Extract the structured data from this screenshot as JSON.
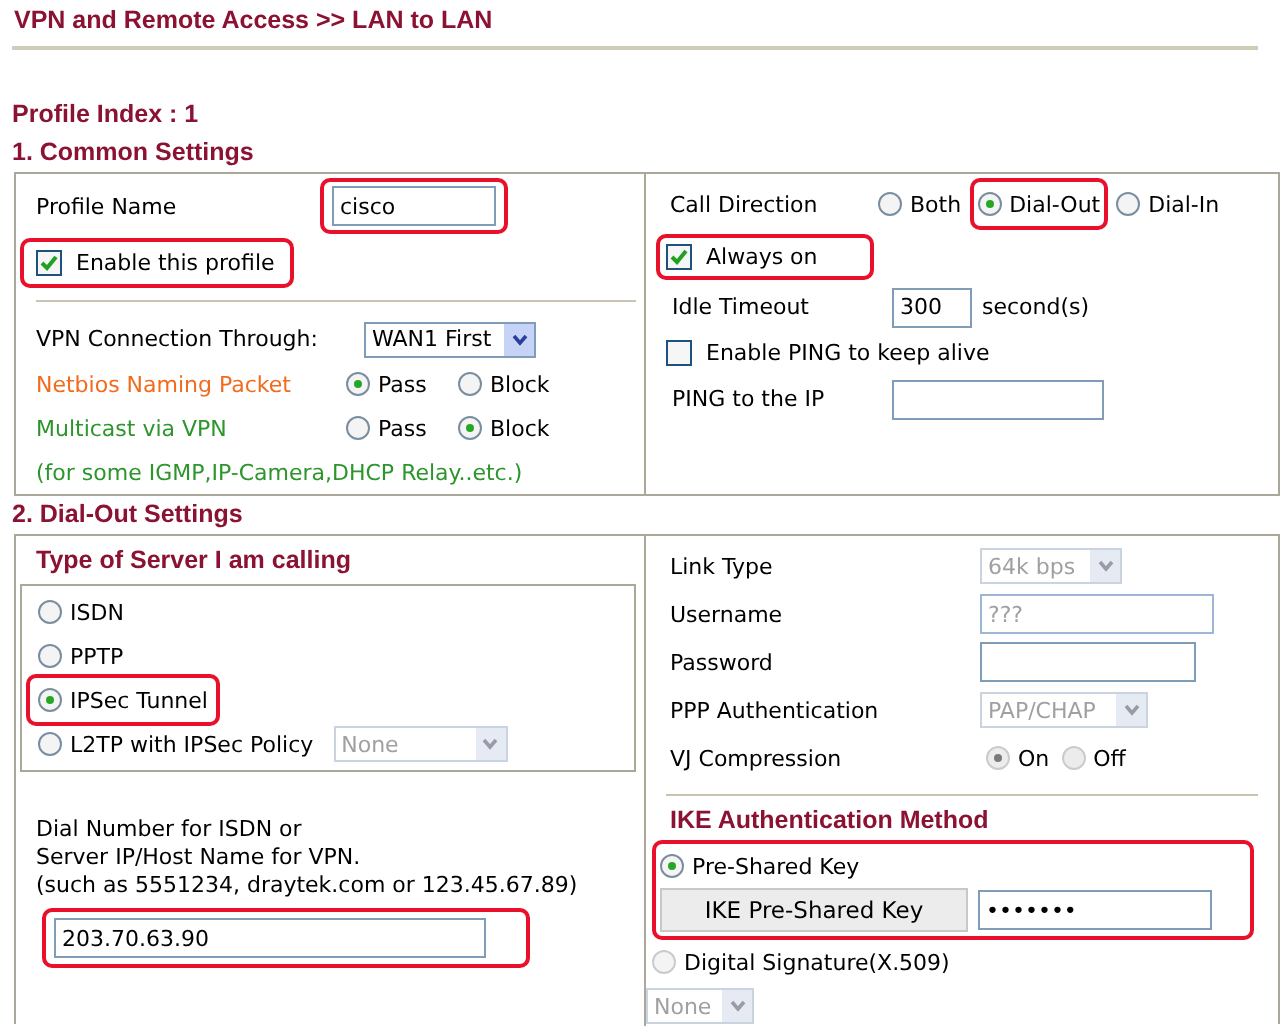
{
  "breadcrumb": "VPN and Remote Access >> LAN to LAN",
  "profile_index": "Profile Index : 1",
  "common_settings": {
    "title": "1. Common Settings",
    "profile_name": {
      "label": "Profile Name",
      "value": "cisco",
      "highlighted": true
    },
    "enable_profile": {
      "label": "Enable this profile",
      "checked": true,
      "highlighted": true
    },
    "vpn_connection": {
      "label": "VPN Connection Through:",
      "value": "WAN1 First"
    },
    "netbios": {
      "label": "Netbios Naming Packet",
      "options": [
        {
          "label": "Pass",
          "selected": true
        },
        {
          "label": "Block",
          "selected": false
        }
      ]
    },
    "multicast": {
      "label": "Multicast via VPN",
      "options": [
        {
          "label": "Pass",
          "selected": false
        },
        {
          "label": "Block",
          "selected": true
        }
      ]
    },
    "note": "(for some IGMP,IP-Camera,DHCP Relay..etc.)",
    "call_direction": {
      "label": "Call Direction",
      "options": [
        {
          "label": "Both",
          "selected": false,
          "highlighted": false
        },
        {
          "label": "Dial-Out",
          "selected": true,
          "highlighted": true
        },
        {
          "label": "Dial-In",
          "selected": false,
          "highlighted": false
        }
      ]
    },
    "always_on": {
      "label": "Always on",
      "checked": true,
      "highlighted": true
    },
    "idle_timeout": {
      "label": "Idle Timeout",
      "value": "300",
      "unit": "second(s)"
    },
    "enable_ping": {
      "label": "Enable PING to keep alive",
      "checked": false
    },
    "ping_ip": {
      "label": "PING to the IP"
    }
  },
  "dial_out_settings": {
    "title": "2. Dial-Out Settings",
    "server_type": {
      "title": "Type of Server I am calling",
      "options": [
        {
          "label": "ISDN",
          "selected": false,
          "highlighted": false
        },
        {
          "label": "PPTP",
          "selected": false,
          "highlighted": false
        },
        {
          "label": "IPSec Tunnel",
          "selected": true,
          "highlighted": true
        },
        {
          "label": "L2TP with IPSec Policy",
          "selected": false,
          "highlighted": false
        }
      ],
      "policy": {
        "value": "None",
        "disabled": true
      }
    },
    "dial_number": {
      "label_lines": [
        "Dial Number for ISDN or",
        "Server IP/Host Name for VPN.",
        "(such as 5551234, draytek.com or 123.45.67.89)"
      ],
      "value": "203.70.63.90",
      "highlighted": true
    },
    "link_type": {
      "label": "Link Type",
      "value": "64k bps",
      "disabled": true
    },
    "username": {
      "label": "Username",
      "value": "???",
      "disabled": true
    },
    "password": {
      "label": "Password"
    },
    "ppp_auth": {
      "label": "PPP Authentication",
      "value": "PAP/CHAP",
      "disabled": true
    },
    "vj_compression": {
      "label": "VJ Compression",
      "disabled": true,
      "options": [
        {
          "label": "On",
          "selected": true
        },
        {
          "label": "Off",
          "selected": false
        }
      ]
    },
    "ike": {
      "title": "IKE Authentication Method",
      "highlighted": true,
      "pre_shared": {
        "label": "Pre-Shared Key",
        "selected": true
      },
      "key_button": "IKE Pre-Shared Key",
      "key_value": "•••••••",
      "signature": {
        "label": "Digital Signature(X.509)",
        "selected": false
      },
      "signature_select": {
        "value": "None",
        "disabled": true
      }
    }
  }
}
